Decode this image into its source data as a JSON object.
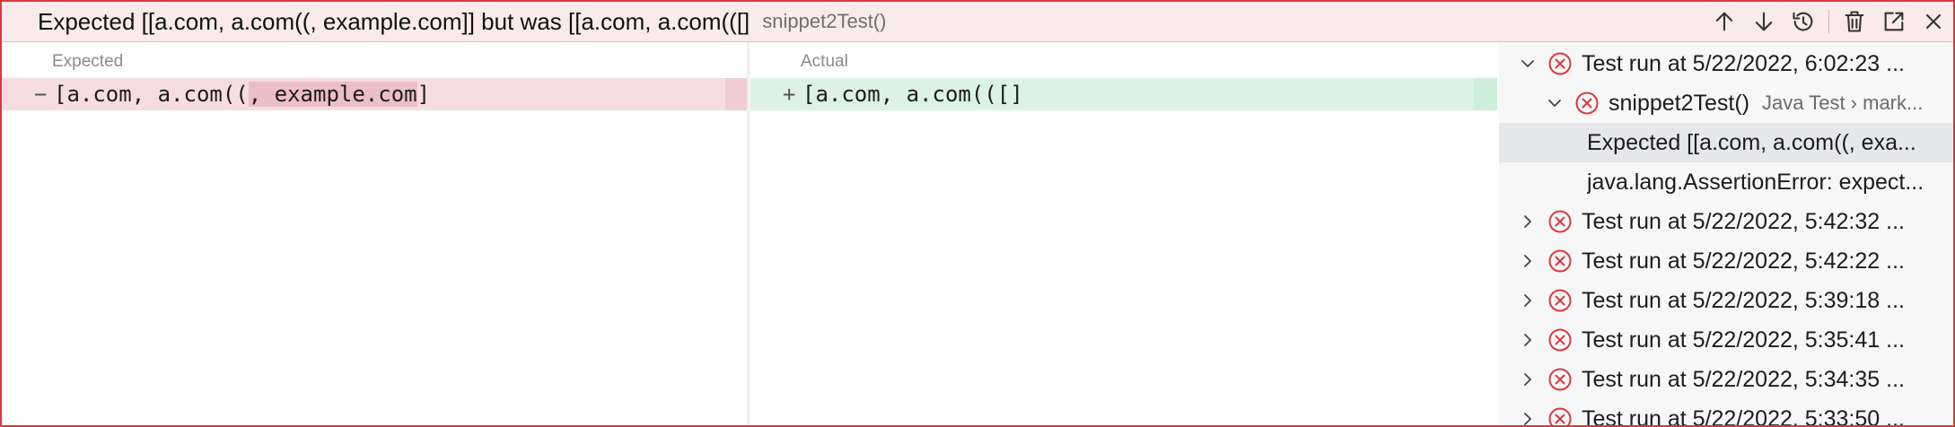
{
  "header": {
    "message": "Expected [[a.com, a.com((, example.com]] but was [[a.com, a.com(([]",
    "test_name": "snippet2Test()",
    "icons": [
      "arrow-up-icon",
      "arrow-down-icon",
      "history-icon",
      "trash-icon",
      "open-external-icon",
      "close-icon"
    ]
  },
  "diff": {
    "expected_label": "Expected",
    "actual_label": "Actual",
    "expected_sign": "−",
    "expected_text_pre": "[a.com, a.com((",
    "expected_text_hl": ", example.com",
    "expected_text_post": "]",
    "actual_sign": "+",
    "actual_text": "[a.com, a.com(([]"
  },
  "tree": {
    "rows": [
      {
        "label": "Test run at 5/22/2022, 6:02:23 ...",
        "expanded": true
      },
      {
        "label": "snippet2Test()",
        "sub": "Java Test › mark...",
        "expanded": true
      },
      {
        "label": "Expected [[a.com, a.com((, exa..."
      },
      {
        "label": "java.lang.AssertionError: expect..."
      },
      {
        "label": "Test run at 5/22/2022, 5:42:32 ..."
      },
      {
        "label": "Test run at 5/22/2022, 5:42:22 ..."
      },
      {
        "label": "Test run at 5/22/2022, 5:39:18 ..."
      },
      {
        "label": "Test run at 5/22/2022, 5:35:41 ..."
      },
      {
        "label": "Test run at 5/22/2022, 5:34:35 ..."
      },
      {
        "label": "Test run at 5/22/2022, 5:33:50 ..."
      }
    ]
  },
  "colors": {
    "error": "#d9393f",
    "header_bg": "#fbeaec",
    "removed_bg": "#f6dde1",
    "added_bg": "#dcf3e4"
  }
}
